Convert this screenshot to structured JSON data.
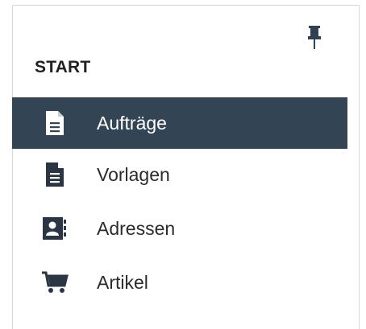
{
  "sidebar": {
    "section_title": "START",
    "pin_icon": "pin-icon",
    "active_background": "#334555",
    "items": [
      {
        "label": "Aufträge",
        "icon": "document-icon",
        "active": true
      },
      {
        "label": "Vorlagen",
        "icon": "template-document-icon",
        "active": false
      },
      {
        "label": "Adressen",
        "icon": "address-book-icon",
        "active": false
      },
      {
        "label": "Artikel",
        "icon": "shopping-cart-icon",
        "active": false
      }
    ]
  }
}
